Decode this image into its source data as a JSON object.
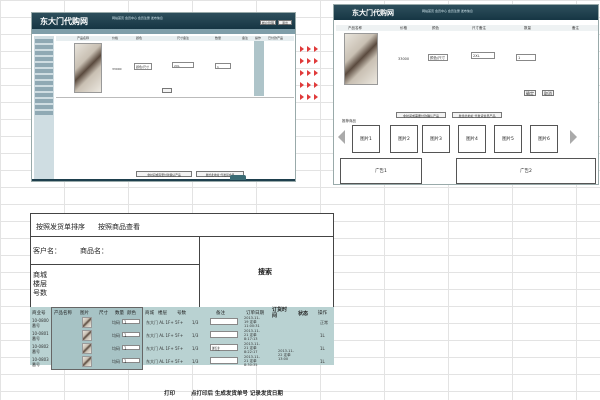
{
  "left_screenshot": {
    "logo": "东大门代购网",
    "nav_text": "网站首页  会员中心  会员注册  发布信息",
    "top_buttons": [
      "帐户管理",
      "退出"
    ],
    "sidebar_items": [
      "账户管理",
      "充值记录",
      "已发货单",
      "已付款单",
      "代购清单",
      "退货管理",
      "收货地址",
      "个人资料",
      "站内信件",
      "我的收藏",
      "积分兑换",
      "推荐有奖",
      "安全中心"
    ],
    "columns": [
      "产品名称",
      "价格",
      "颜色",
      "尺寸备注",
      "数量",
      "备注",
      "操作",
      "已付款产品"
    ],
    "price": "33000",
    "color": "颜色/尺寸",
    "size_note": "2XL",
    "quantity": "1",
    "bottom_buttons": [
      "非时间或需要付款确认产品",
      "发给此地址 代发货会员"
    ]
  },
  "right_screenshot": {
    "logo": "东大门代购网",
    "nav_text": "网站首页  会员中心  会员注册  发布信息",
    "columns": [
      "产品名称",
      "价格",
      "颜色",
      "尺寸备注",
      "数量",
      "备注"
    ],
    "price": "33000",
    "color": "颜色/尺寸",
    "size_note": "2XL",
    "quantity": "1",
    "action_buttons": [
      "确定",
      "取消"
    ],
    "bottom_buttons": [
      "非时间或需要付款确认产品",
      "发给此地址 代发货会员产品"
    ],
    "gallery_title": "推荐商品",
    "gallery_items": [
      "图片1",
      "图片2",
      "图片3",
      "图片4",
      "图片5",
      "图片6"
    ],
    "ads": [
      "广告1",
      "广告2"
    ]
  },
  "search_form": {
    "sort_by_ship": "按照发货单排序",
    "sort_by_product": "按照商品查看",
    "customer_label": "客户名：",
    "product_label": "商品名：",
    "search_button": "搜索",
    "mall_lines": [
      "商城",
      "楼层",
      "号数"
    ]
  },
  "orders_table": {
    "headers": [
      "商业号",
      "产品名称",
      "图片",
      "尺寸",
      "数量",
      "颜色",
      "商城",
      "楼层",
      "号数",
      "备注",
      "订单日期",
      "订货时间",
      "状态",
      "操作"
    ],
    "rows": [
      {
        "id": "10-0800 番号",
        "size": "均码",
        "qty": "1",
        "mall": "东大门 AL 1F+ 5F+",
        "floor": "1/3",
        "date": "2013-11-19 定单 11:00:31",
        "status": "正常"
      },
      {
        "id": "10-0801 番号",
        "size": "均码",
        "qty": "1",
        "mall": "东大门 AL 1F+ 5F+",
        "floor": "1/3",
        "date": "2013-11-21 定单 8:17:13",
        "status": "1L"
      },
      {
        "id": "10-0802 番号",
        "size": "均码",
        "qty": "1",
        "mall": "东大门 AL 1F+ 5F+",
        "floor": "1/3",
        "note": "附注",
        "date": "2013-11-21 定单 8:22:17",
        "status": "1L"
      },
      {
        "id": "10-0803 番号",
        "size": "均码",
        "qty": "1",
        "mall": "东大门 AL 1F+ 5F+",
        "floor": "1/3",
        "date": "2013-11-21 定单 8:30:35",
        "date2": "2013-11-22 定单 13:00",
        "status": "1L"
      }
    ]
  },
  "footer_actions": [
    "打印",
    "点打印后 生成发货单号 记录发货日期"
  ],
  "colors": {
    "banner": "#1e3f4d",
    "sidebar": "#cfdde2",
    "table_bg": "#b9d2d2",
    "arrows": "#e03a3a"
  }
}
